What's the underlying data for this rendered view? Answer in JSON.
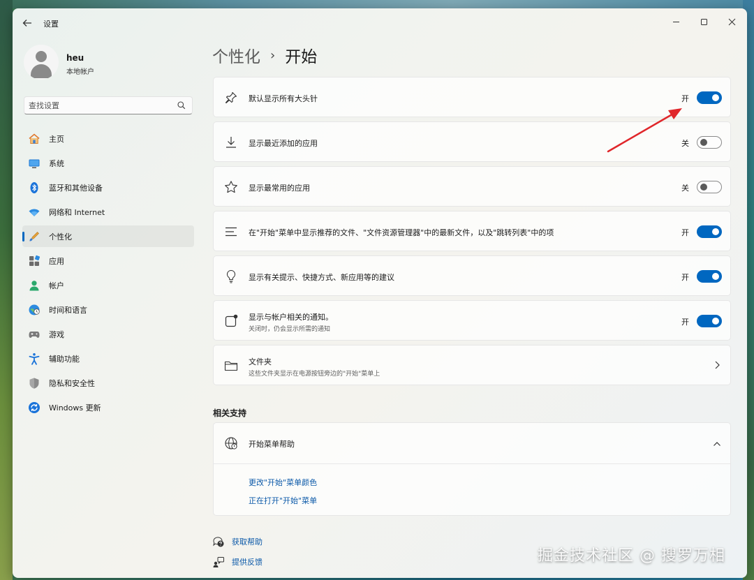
{
  "window": {
    "title": "设置",
    "controls": {
      "minimize": "–",
      "maximize": "☐",
      "close": "✕"
    }
  },
  "profile": {
    "name": "heu",
    "account_type": "本地帐户"
  },
  "search": {
    "placeholder": "查找设置"
  },
  "sidebar": {
    "items": [
      {
        "label": "主页",
        "icon": "home-icon"
      },
      {
        "label": "系统",
        "icon": "system-icon"
      },
      {
        "label": "蓝牙和其他设备",
        "icon": "bluetooth-icon"
      },
      {
        "label": "网络和 Internet",
        "icon": "wifi-icon"
      },
      {
        "label": "个性化",
        "icon": "personalization-icon",
        "active": true
      },
      {
        "label": "应用",
        "icon": "apps-icon"
      },
      {
        "label": "帐户",
        "icon": "account-icon"
      },
      {
        "label": "时间和语言",
        "icon": "time-language-icon"
      },
      {
        "label": "游戏",
        "icon": "gaming-icon"
      },
      {
        "label": "辅助功能",
        "icon": "accessibility-icon"
      },
      {
        "label": "隐私和安全性",
        "icon": "privacy-shield-icon"
      },
      {
        "label": "Windows 更新",
        "icon": "windows-update-icon"
      }
    ]
  },
  "breadcrumb": {
    "parent": "个性化",
    "separator": "›",
    "current": "开始"
  },
  "settings": [
    {
      "title": "默认显示所有大头针",
      "state": "开",
      "on": true,
      "icon": "pin-icon"
    },
    {
      "title": "显示最近添加的应用",
      "state": "关",
      "on": false,
      "icon": "download-icon"
    },
    {
      "title": "显示最常用的应用",
      "state": "关",
      "on": false,
      "icon": "star-icon"
    },
    {
      "title": "在\"开始\"菜单中显示推荐的文件、\"文件资源管理器\"中的最新文件，以及\"跳转列表\"中的项",
      "state": "开",
      "on": true,
      "icon": "list-icon"
    },
    {
      "title": "显示有关提示、快捷方式、新应用等的建议",
      "state": "开",
      "on": true,
      "icon": "lightbulb-icon"
    },
    {
      "title": "显示与帐户相关的通知。",
      "subtitle": "关闭时，仍会显示所需的通知",
      "state": "开",
      "on": true,
      "icon": "notification-icon"
    },
    {
      "title": "文件夹",
      "subtitle": "这些文件夹显示在电源按钮旁边的\"开始\"菜单上",
      "icon": "folder-icon"
    }
  ],
  "related": {
    "section_title": "相关支持",
    "help_title": "开始菜单帮助",
    "links": [
      "更改\"开始\"菜单颜色",
      "正在打开\"开始\"菜单"
    ]
  },
  "footer": {
    "get_help": "获取帮助",
    "feedback": "提供反馈"
  },
  "watermark": "掘金技术社区 @ 搜罗万相",
  "colors": {
    "accent": "#0067c0",
    "link": "#0a58a8",
    "annotation_arrow": "#e0262a"
  }
}
